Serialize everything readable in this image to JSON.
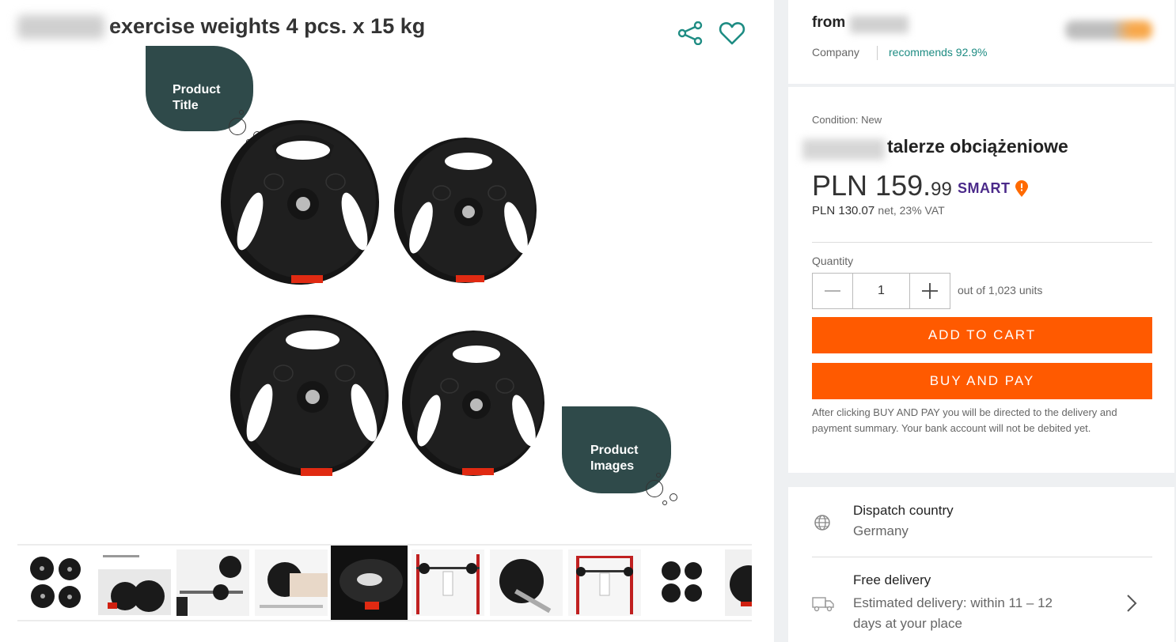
{
  "product": {
    "title": "exercise weights 4 pcs. x 15 kg"
  },
  "annotations": {
    "title_bubble_line1": "Product",
    "title_bubble_line2": "Title",
    "images_bubble_line1": "Product",
    "images_bubble_line2": "Images"
  },
  "icons": {
    "share": "share-icon",
    "favorite": "heart-icon",
    "globe": "globe-icon",
    "truck": "truck-icon",
    "chevron": "chevron-right-icon"
  },
  "thumbnails": [
    "plates-4",
    "plates-chart",
    "barbell-lift",
    "plate-hand",
    "plate-dark",
    "rack-1",
    "plate-bar",
    "rack-2",
    "plates-4b",
    "plates-partial"
  ],
  "seller": {
    "from_label": "from",
    "company_label": "Company",
    "recommends": "recommends 92.9%"
  },
  "offer": {
    "condition": "Condition: New",
    "product_name": "talerze obciążeniowe",
    "currency": "PLN",
    "price_whole": "159.",
    "price_decimal": "99",
    "smart_label": "SMART",
    "net_price": "PLN 130.07",
    "vat_label": "net, 23% VAT",
    "quantity_label": "Quantity",
    "quantity_value": "1",
    "stock_text": "out of 1,023 units",
    "add_to_cart": "ADD TO CART",
    "buy_and_pay": "BUY AND PAY",
    "note": "After clicking BUY AND PAY you will be directed to the delivery and payment summary. Your bank account will not be debited yet."
  },
  "shipping": {
    "dispatch_label": "Dispatch country",
    "dispatch_value": "Germany",
    "delivery_label": "Free delivery",
    "delivery_estimate": "Estimated delivery: within 11 – 12 days at your place"
  },
  "colors": {
    "accent": "#ff5a00",
    "teal": "#1e8c83",
    "bubble": "#2f4a4a",
    "smart": "#4b2a8a"
  }
}
